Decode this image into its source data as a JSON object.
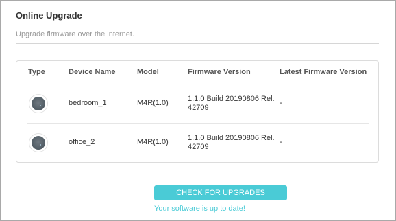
{
  "section": {
    "title": "Online Upgrade",
    "description": "Upgrade firmware over the internet."
  },
  "table": {
    "headers": {
      "type": "Type",
      "device_name": "Device Name",
      "model": "Model",
      "firmware_version": "Firmware Version",
      "latest_firmware_version": "Latest Firmware Version"
    },
    "rows": [
      {
        "type_icon": "deco-device-icon",
        "device_name": "bedroom_1",
        "model": "M4R(1.0)",
        "firmware_version": "1.1.0 Build 20190806 Rel. 42709",
        "latest_firmware_version": "-"
      },
      {
        "type_icon": "deco-device-icon",
        "device_name": "office_2",
        "model": "M4R(1.0)",
        "firmware_version": "1.1.0 Build 20190806 Rel. 42709",
        "latest_firmware_version": "-"
      }
    ]
  },
  "actions": {
    "check_label": "CHECK FOR UPGRADES",
    "status_message": "Your software is up to date!"
  },
  "colors": {
    "accent": "#4acbd6",
    "muted_text": "#9a9a9a",
    "border": "#dcdcdc"
  }
}
